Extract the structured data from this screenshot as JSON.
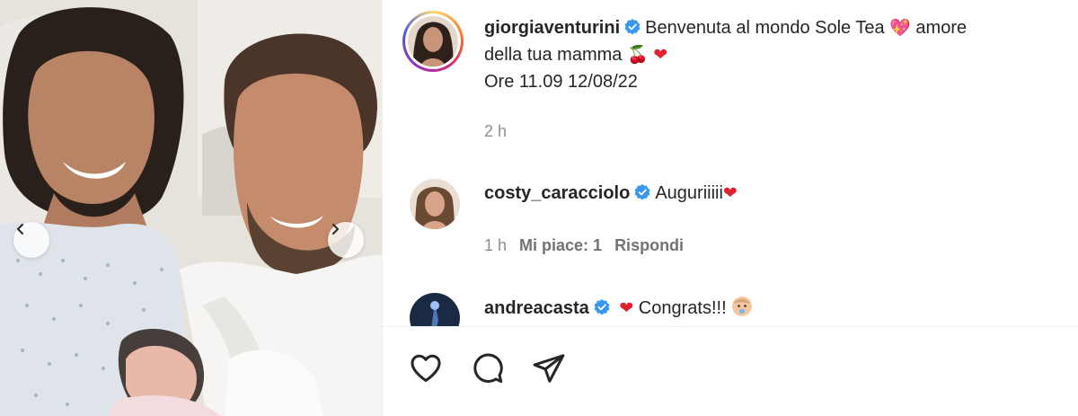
{
  "post": {
    "image_alt": "Foto neonata con mamma e papà",
    "caption": {
      "username": "giorgiaventurini",
      "line1": "Benvenuta al mondo Sole Tea",
      "line1_end": "amore",
      "line2": "della tua mamma",
      "line3": "Ore 11.09 12/08/22",
      "time": "2 h"
    },
    "comments": [
      {
        "username": "costy_caracciolo",
        "text": "Auguriiiii",
        "time": "1 h",
        "likes": "Mi piace: 1",
        "reply": "Rispondi"
      },
      {
        "username": "andreacasta",
        "text": "Congrats!!!"
      }
    ]
  },
  "icons": {
    "verified": "verified-badge-icon",
    "heart": "heart-icon",
    "comment": "comment-icon",
    "share": "share-icon",
    "prev": "chevron-left-icon",
    "next": "chevron-right-icon"
  },
  "colors": {
    "verified": "#3897f0",
    "heart_emoji": "#e0222f",
    "text": "#262626",
    "muted": "#8e8e8e"
  }
}
